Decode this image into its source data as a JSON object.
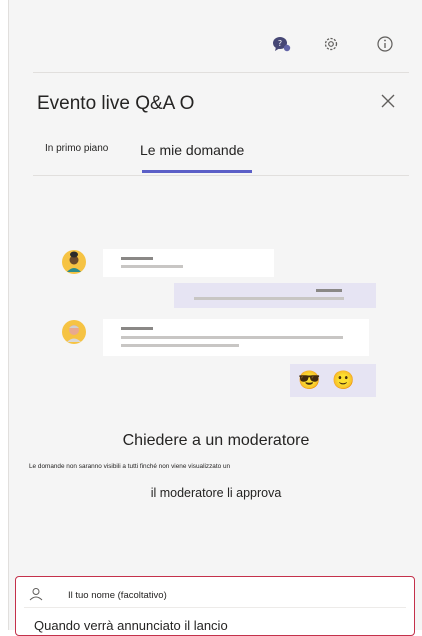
{
  "header": {
    "icons": [
      "qa-chat-icon",
      "gear-icon",
      "info-icon"
    ],
    "title": "Evento live Q&A O",
    "close_icon": "close-icon"
  },
  "tabs": [
    {
      "label": "In primo piano",
      "selected": false
    },
    {
      "label": "Le mie domande",
      "selected": true
    }
  ],
  "empty_state": {
    "heading": "Chiedere a un moderatore",
    "description_line1": "Le domande non saranno visibili a tutti finché non viene visualizzato un",
    "description_line2": "il moderatore li approva",
    "emojis": [
      "😎",
      "🙂"
    ]
  },
  "compose": {
    "name_placeholder": "Il tuo nome (facoltativo)",
    "question_placeholder": "Quando verrà annunciato il lancio"
  },
  "colors": {
    "accent": "#5b5fc7",
    "error_border": "#c4314b",
    "bubble_purple": "#e6e4f3"
  }
}
